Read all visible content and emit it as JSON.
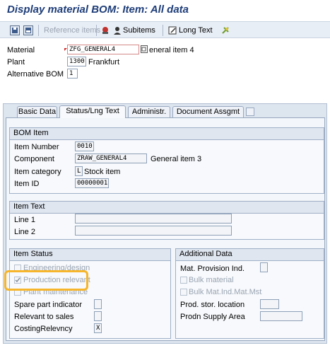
{
  "title": "Display material BOM: Item: All data",
  "toolbar": {
    "reference_items": "Reference items",
    "subitems": "Subitems",
    "long_text": "Long Text"
  },
  "header": {
    "material_label": "Material",
    "material_value": "ZFG_GENERAL4",
    "material_desc": "eneral item 4",
    "plant_label": "Plant",
    "plant_value": "1300",
    "plant_desc": "Frankfurt",
    "altbom_label": "Alternative BOM",
    "altbom_value": "1"
  },
  "tabs": [
    {
      "label": "Basic Data",
      "active": false
    },
    {
      "label": "Status/Lng Text",
      "active": true
    },
    {
      "label": "Administr.",
      "active": false
    },
    {
      "label": "Document Assgmt",
      "active": false
    }
  ],
  "bom_item": {
    "title": "BOM Item",
    "item_number_label": "Item Number",
    "item_number_value": "0010",
    "component_label": "Component",
    "component_value": "ZRAW_GENERAL4",
    "component_desc": "General item 3",
    "item_category_label": "Item category",
    "item_category_value": "L",
    "item_category_desc": "Stock item",
    "item_id_label": "Item ID",
    "item_id_value": "00000001"
  },
  "item_text": {
    "title": "Item Text",
    "line1_label": "Line 1",
    "line1_value": "",
    "line2_label": "Line 2",
    "line2_value": ""
  },
  "item_status": {
    "title": "Item Status",
    "engineering_design": "Engineering/design",
    "production_relevant": "Production relevant",
    "production_relevant_checked": true,
    "plant_maintenance": "Plant maintenance",
    "spare_part_label": "Spare part indicator",
    "spare_part_value": "",
    "relevant_sales_label": "Relevant to sales",
    "relevant_sales_value": "",
    "costing_label": "CostingRelevncy",
    "costing_value": "X"
  },
  "additional_data": {
    "title": "Additional Data",
    "mat_provision_label": "Mat. Provision Ind.",
    "mat_provision_value": "",
    "bulk_material": "Bulk material",
    "bulk_mat_ind": "Bulk Mat.Ind.Mat.Mst",
    "prod_stor_label": "Prod. stor. location",
    "prod_stor_value": "",
    "prodn_supply_label": "Prodn Supply Area",
    "prodn_supply_value": ""
  },
  "colors": {
    "title": "#1e3d78",
    "highlight": "#f6b52a",
    "required_marker": "#d42a2a"
  },
  "icons": [
    "save-icon",
    "other-bom-icon",
    "reference-items-icon",
    "bom-icon",
    "subitems-icon",
    "long-text-icon",
    "settings-icon",
    "matchcode-icon"
  ]
}
